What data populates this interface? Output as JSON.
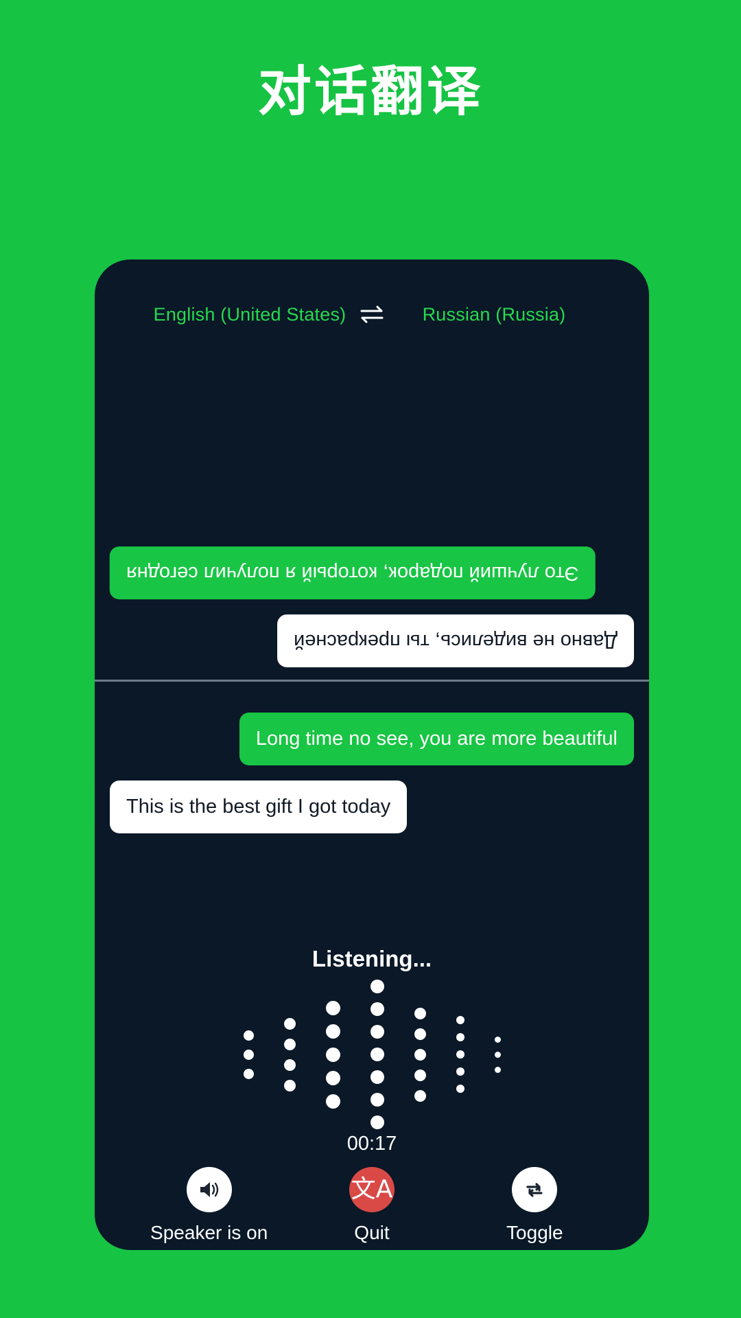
{
  "page": {
    "title": "对话翻译",
    "background_color": "#16C343",
    "card_color": "#0A1828",
    "accent_green": "#18C544",
    "quit_red": "#D94A47"
  },
  "language_bar": {
    "source_language": "English (United States)",
    "target_language": "Russian (Russia)",
    "swap_icon": "swap-horizontal-icon"
  },
  "conversation": {
    "top_pane": [
      {
        "text": "Это лучший подарок, который я получил сегодня",
        "style": "green",
        "align": "left",
        "rotated": true
      },
      {
        "text": "Давно не виделись, ты прекрасней",
        "style": "white",
        "align": "right",
        "rotated": true
      }
    ],
    "bottom_pane": [
      {
        "text": "Long time no see, you are more beautiful",
        "style": "green",
        "align": "right",
        "rotated": false
      },
      {
        "text": "This is the best gift I got today",
        "style": "white",
        "align": "left",
        "rotated": false
      }
    ]
  },
  "status": {
    "listening_label": "Listening...",
    "timer": "00:17"
  },
  "waveform": {
    "columns": [
      {
        "dots": 3,
        "size": 15
      },
      {
        "dots": 4,
        "size": 17
      },
      {
        "dots": 5,
        "size": 21
      },
      {
        "dots": 7,
        "size": 20
      },
      {
        "dots": 5,
        "size": 17
      },
      {
        "dots": 5,
        "size": 12
      },
      {
        "dots": 3,
        "size": 9
      }
    ],
    "gap": 13,
    "color": "#ffffff"
  },
  "controls": [
    {
      "label": "Speaker is on",
      "icon": "speaker-on-icon",
      "circle": "white"
    },
    {
      "label": "Quit",
      "icon": "translate-icon",
      "circle": "red"
    },
    {
      "label": "Toggle",
      "icon": "toggle-repeat-icon",
      "circle": "white"
    }
  ]
}
